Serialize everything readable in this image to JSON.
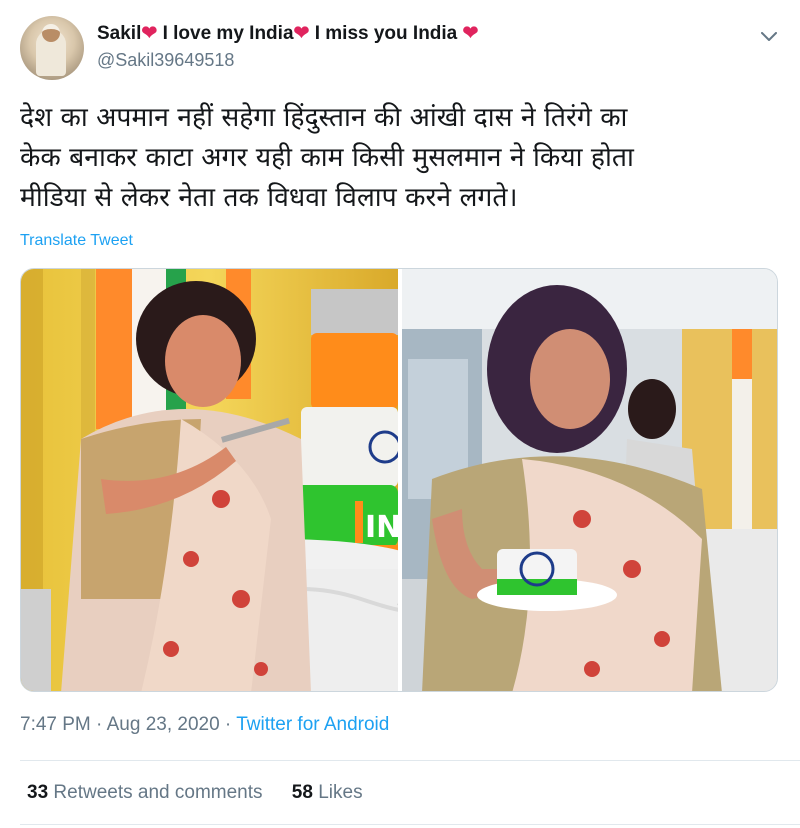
{
  "tweet": {
    "author": {
      "display_name": "Sakil",
      "name_part_2": " I love my India",
      "name_part_3": " I miss you India ",
      "heart_glyph": "❤",
      "handle": "@Sakil39649518"
    },
    "text": "देश का अपमान नहीं सहेगा हिंदुस्तान की आंखी दास ने तिरंगे का\nकेक बनाकर काटा अगर यही काम किसी मुसलमान ने किया होता\nमीडिया से लेकर नेता तक विधवा विलाप करने लगते।",
    "translate_label": "Translate Tweet",
    "media": {
      "cake_text": "IN"
    },
    "time": "7:47 PM",
    "separator_1": " · ",
    "date": "Aug 23, 2020",
    "separator_2": " · ",
    "source": "Twitter for Android",
    "stats": {
      "retweets_count": "33",
      "retweets_label": " Retweets and comments",
      "likes_count": "58",
      "likes_label": " Likes"
    }
  },
  "colors": {
    "link": "#1da1f2",
    "heart": "#e0245e",
    "secondary_text": "#657786",
    "primary_text": "#14171a"
  },
  "icons": [
    "more-options-chevron-icon",
    "heart-icon"
  ]
}
